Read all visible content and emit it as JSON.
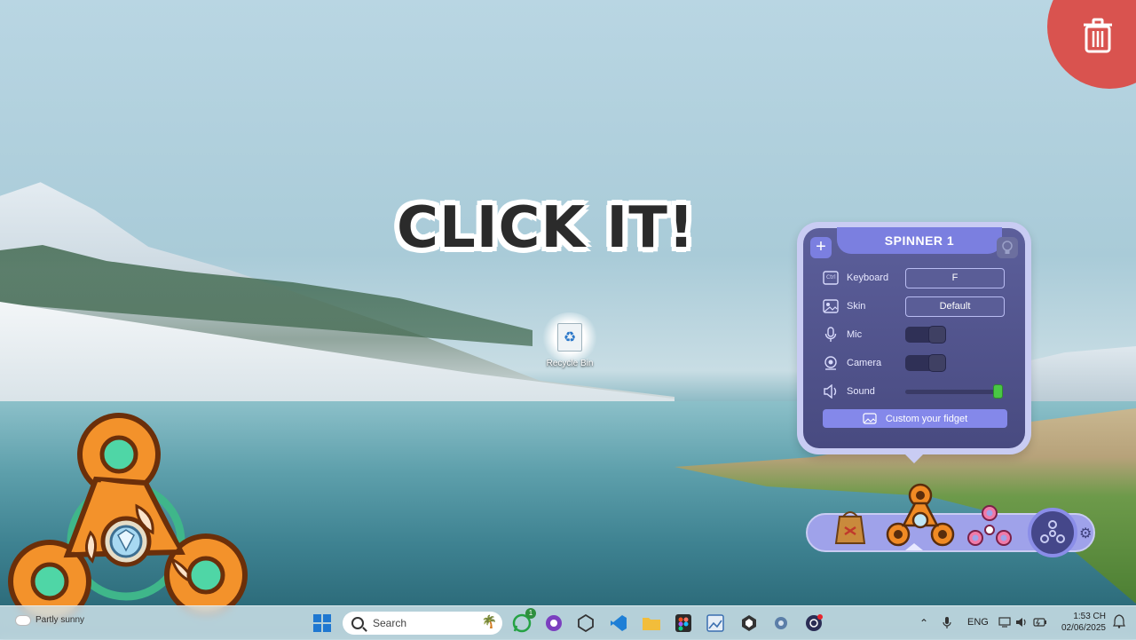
{
  "headline": "CLICK IT!",
  "desktop": {
    "recycle_bin_label": "Recycle Bin"
  },
  "panel": {
    "title": "SPINNER 1",
    "add_label": "+",
    "rows": {
      "keyboard": {
        "label": "Keyboard",
        "value": "F"
      },
      "skin": {
        "label": "Skin",
        "value": "Default"
      },
      "mic": {
        "label": "Mic",
        "on": false
      },
      "camera": {
        "label": "Camera",
        "on": false
      },
      "sound": {
        "label": "Sound",
        "level": 1.0
      }
    },
    "custom_button": "Custom your fidget"
  },
  "selector": {
    "items": [
      "paper-bag-icon",
      "orange-spinner-icon",
      "pink-spinner-icon"
    ],
    "selected_index": 1
  },
  "taskbar": {
    "weather": "Partly sunny",
    "search_placeholder": "Search",
    "whatsapp_badge": "1",
    "language": "ENG",
    "time": "1:53 CH",
    "date": "02/06/2025"
  },
  "colors": {
    "panel_accent": "#7b7fe0",
    "panel_bg": "#484a80",
    "trash_zone": "#d9534f",
    "sound_fill": "#4ccb4a"
  }
}
